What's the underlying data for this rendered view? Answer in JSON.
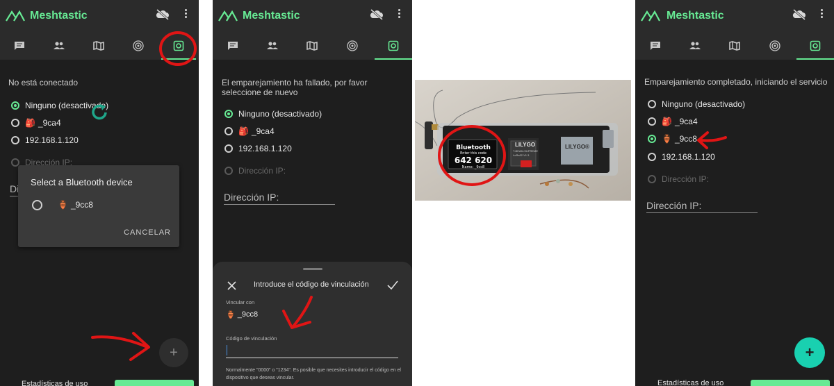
{
  "app": {
    "title": "Meshtastic"
  },
  "icons": {
    "logo": "meshtastic-logo-icon",
    "cloud": "cloud-off-icon",
    "menu": "more-vert-icon",
    "tabs": [
      "messages-icon",
      "users-icon",
      "map-icon",
      "channel-icon",
      "settings-icon"
    ]
  },
  "colors": {
    "accent": "#67ea94",
    "background": "#1e1e1e",
    "bar": "#2b2b2b",
    "annotation": "#e01515"
  },
  "screen1": {
    "status": "No está conectado",
    "options": [
      "Ninguno (desactivado)",
      "_9ca4",
      "192.168.1.120"
    ],
    "ip_option": "Dirección IP:",
    "ip_field_partial": "Di",
    "dialog": {
      "title": "Select a Bluetooth device",
      "device": "_9cc8",
      "cancel": "CANCELAR"
    },
    "fab": "+",
    "bottom_text": "Estadísticas de uso"
  },
  "screen2": {
    "status": "El emparejamiento ha fallado, por favor seleccione de nuevo",
    "options": [
      "Ninguno (desactivado)",
      "_9ca4",
      "192.168.1.120"
    ],
    "ip_option": "Dirección IP:",
    "ip_field": "Dirección IP:",
    "sheet": {
      "title": "Introduce el código de vinculación",
      "link_label": "Vincular con",
      "device": "_9cc8",
      "code_label": "Código de vinculación",
      "note": "Normalmente \"0000\" o \"1234\". Es posible que necesites introducir el código en el dispositivo que deseas vincular."
    }
  },
  "photo": {
    "oled_title": "Bluetooth",
    "oled_sub": "Enter this code",
    "oled_code": "642 620",
    "oled_name": "Name: _9cc8",
    "brand": "LILYGO",
    "brand2": "LILYGO®",
    "chip_text": "T-BEAM-SUPREME",
    "board_text": "LoRa32 V1.3"
  },
  "screen4": {
    "status": "Emparejamiento completado, iniciando el servicio",
    "options": [
      "Ninguno (desactivado)",
      "_9ca4",
      "_9cc8",
      "192.168.1.120"
    ],
    "ip_option": "Dirección IP:",
    "ip_field": "Dirección IP:",
    "fab": "+",
    "bottom_text": "Estadísticas de uso"
  }
}
